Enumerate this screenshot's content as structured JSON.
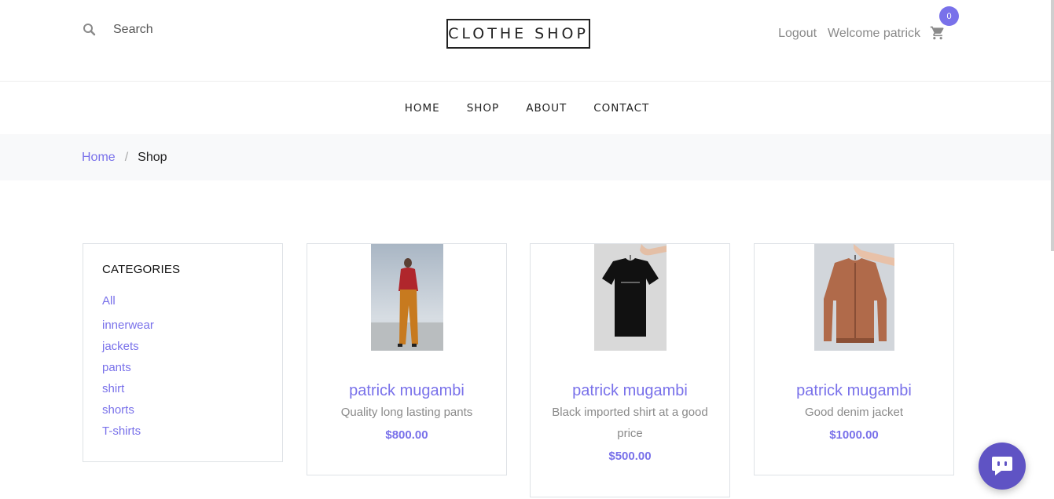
{
  "search": {
    "placeholder": "Search"
  },
  "logo": "CLOTHE SHOP",
  "user": {
    "logout": "Logout",
    "welcome": "Welcome patrick",
    "cart_count": "0"
  },
  "nav": {
    "items": [
      {
        "label": "HOME"
      },
      {
        "label": "SHOP"
      },
      {
        "label": "ABOUT"
      },
      {
        "label": "CONTACT"
      }
    ]
  },
  "breadcrumb": {
    "home": "Home",
    "separator": "/",
    "current": "Shop"
  },
  "categories": {
    "title": "CATEGORIES",
    "items": [
      "All",
      "innerwear",
      "jackets",
      "pants",
      "shirt",
      "shorts",
      "T-shirts"
    ]
  },
  "products": [
    {
      "name": "patrick mugambi",
      "description": "Quality long lasting pants",
      "price": "$800.00",
      "image": "woman-orange-pants-photo"
    },
    {
      "name": "patrick mugambi",
      "description": "Black imported shirt at a good price",
      "price": "$500.00",
      "image": "black-tshirt-on-hanger-photo"
    },
    {
      "name": "patrick mugambi",
      "description": "Good denim jacket",
      "price": "$1000.00",
      "image": "brown-jacket-on-hanger-photo"
    }
  ],
  "colors": {
    "accent": "#7971ea",
    "chat": "#5f53c4",
    "breadcrumb_bg": "#f8f9fa"
  },
  "icons": {
    "search": "search-icon",
    "cart": "cart-icon",
    "chat": "chat-icon"
  }
}
